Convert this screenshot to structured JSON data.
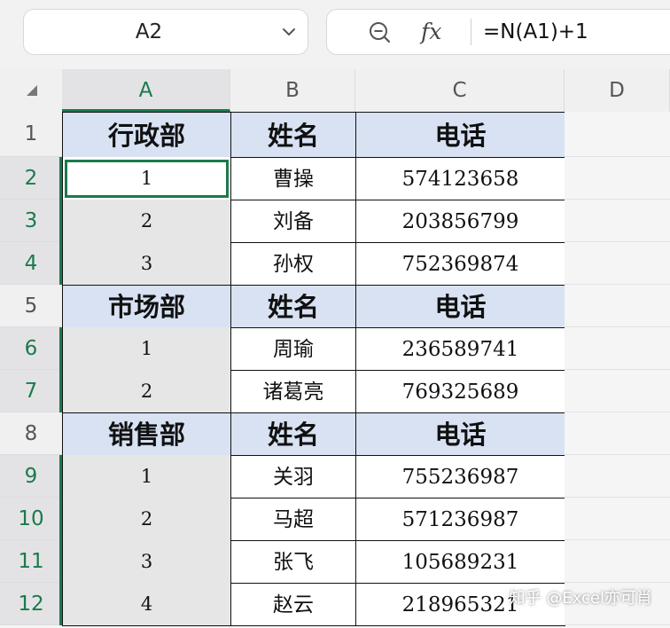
{
  "name_box": {
    "value": "A2"
  },
  "formula_bar": {
    "fx_label": "fx",
    "formula": "=N(A1)+1"
  },
  "columns": [
    {
      "label": "A",
      "selected": true
    },
    {
      "label": "B",
      "selected": false
    },
    {
      "label": "C",
      "selected": false
    },
    {
      "label": "D",
      "selected": false
    }
  ],
  "rows": [
    {
      "num": "1",
      "selected": false,
      "type": "header",
      "a": "行政部",
      "b": "姓名",
      "c": "电话"
    },
    {
      "num": "2",
      "selected": true,
      "type": "data",
      "a": "1",
      "b": "曹操",
      "c": "574123658",
      "active": true
    },
    {
      "num": "3",
      "selected": true,
      "type": "data",
      "a": "2",
      "b": "刘备",
      "c": "203856799"
    },
    {
      "num": "4",
      "selected": true,
      "type": "data",
      "a": "3",
      "b": "孙权",
      "c": "752369874"
    },
    {
      "num": "5",
      "selected": false,
      "type": "header",
      "a": "市场部",
      "b": "姓名",
      "c": "电话"
    },
    {
      "num": "6",
      "selected": true,
      "type": "data",
      "a": "1",
      "b": "周瑜",
      "c": "236589741"
    },
    {
      "num": "7",
      "selected": true,
      "type": "data",
      "a": "2",
      "b": "诸葛亮",
      "c": "769325689"
    },
    {
      "num": "8",
      "selected": false,
      "type": "header",
      "a": "销售部",
      "b": "姓名",
      "c": "电话"
    },
    {
      "num": "9",
      "selected": true,
      "type": "data",
      "a": "1",
      "b": "关羽",
      "c": "755236987"
    },
    {
      "num": "10",
      "selected": true,
      "type": "data",
      "a": "2",
      "b": "马超",
      "c": "571236987"
    },
    {
      "num": "11",
      "selected": true,
      "type": "data",
      "a": "3",
      "b": "张飞",
      "c": "105689231"
    },
    {
      "num": "12",
      "selected": true,
      "type": "data",
      "a": "4",
      "b": "赵云",
      "c": "218965321"
    }
  ],
  "watermark": "知乎 @Excel亦可肖",
  "colors": {
    "accent_green": "#1b7a4b",
    "header_fill": "#d8e2f3",
    "selected_fill": "#e6e6e6"
  }
}
